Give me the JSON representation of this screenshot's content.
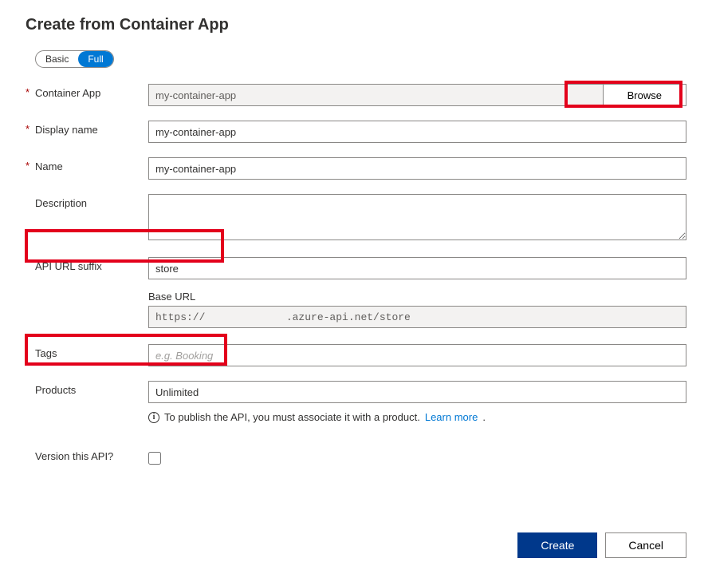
{
  "title": "Create from Container App",
  "toggle": {
    "basic": "Basic",
    "full": "Full",
    "active": "full"
  },
  "labels": {
    "containerApp": "Container App",
    "displayName": "Display name",
    "name": "Name",
    "description": "Description",
    "apiUrlSuffix": "API URL suffix",
    "baseUrl": "Base URL",
    "tags": "Tags",
    "products": "Products",
    "versionThisApi": "Version this API?"
  },
  "values": {
    "containerApp": "my-container-app",
    "displayName": "my-container-app",
    "name": "my-container-app",
    "description": "",
    "apiUrlSuffix": "store",
    "baseUrl": "https://             .azure-api.net/store",
    "tags": "",
    "products": "Unlimited",
    "versionThisApi": false
  },
  "placeholders": {
    "tags": "e.g. Booking"
  },
  "buttons": {
    "browse": "Browse",
    "create": "Create",
    "cancel": "Cancel"
  },
  "helper": {
    "text": "To publish the API, you must associate it with a product. ",
    "link": "Learn more"
  }
}
